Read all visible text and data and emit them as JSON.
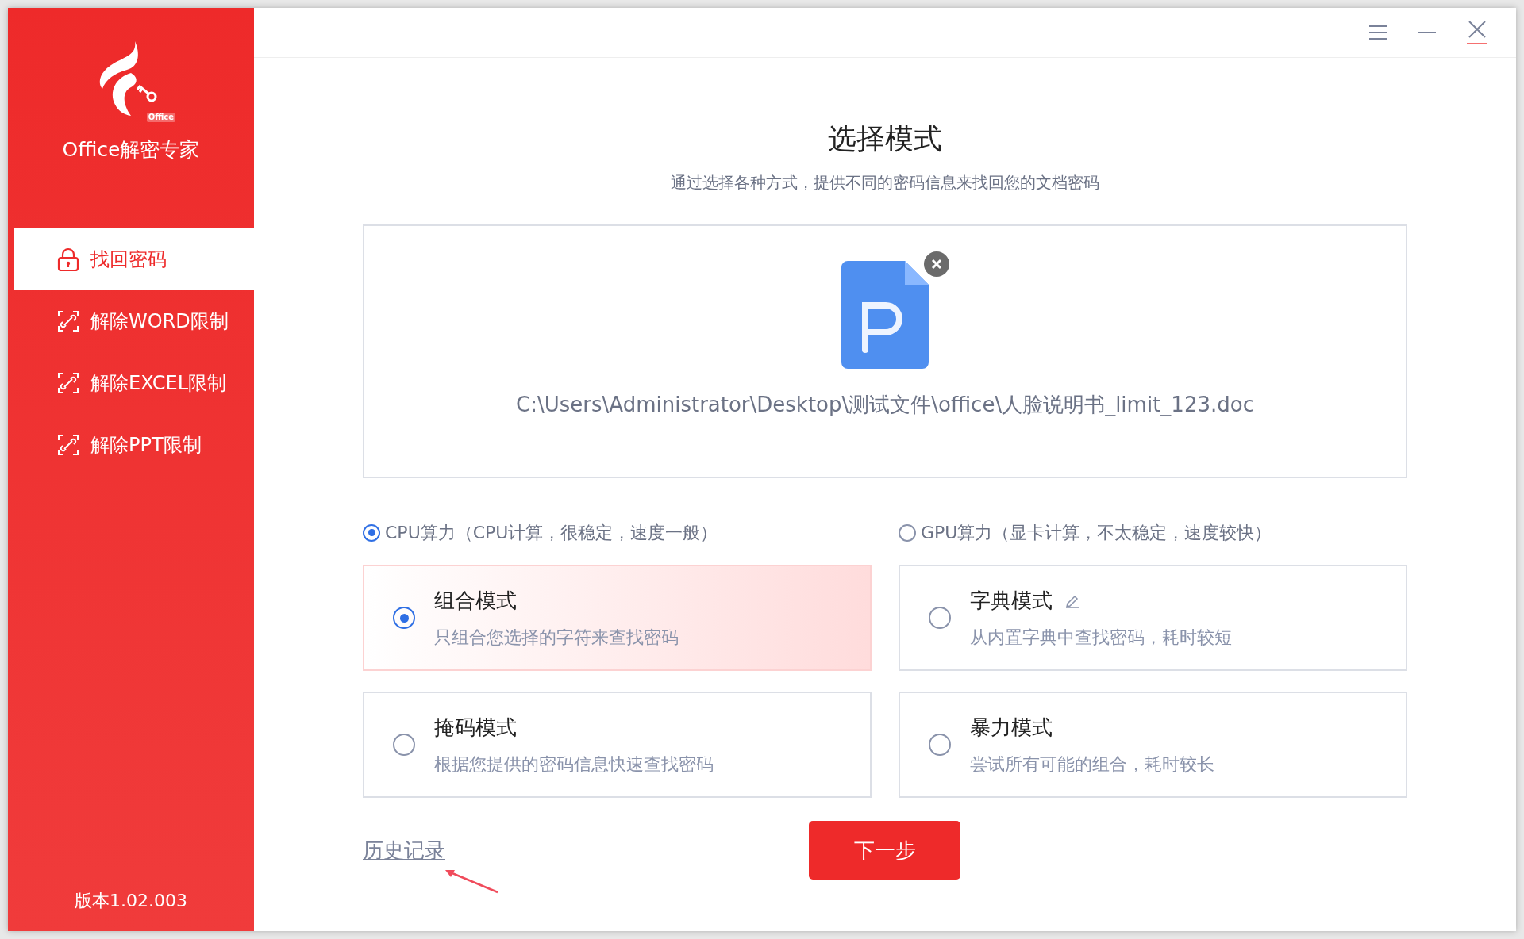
{
  "app": {
    "name": "Office解密专家",
    "logo_badge": "Office",
    "version": "版本1.02.003"
  },
  "sidebar": {
    "items": [
      {
        "label": "找回密码",
        "kind": "lock",
        "selected": true
      },
      {
        "label": "解除WORD限制",
        "kind": "unlock",
        "selected": false
      },
      {
        "label": "解除EXCEL限制",
        "kind": "unlock",
        "selected": false
      },
      {
        "label": "解除PPT限制",
        "kind": "unlock",
        "selected": false
      }
    ]
  },
  "header": {
    "title": "选择模式",
    "subtitle": "通过选择各种方式，提供不同的密码信息来找回您的文档密码"
  },
  "file": {
    "path": "C:\\Users\\Administrator\\Desktop\\测试文件\\office\\人脸说明书_limit_123.doc"
  },
  "compute": [
    {
      "label": "CPU算力（CPU计算，很稳定，速度一般）",
      "selected": true
    },
    {
      "label": "GPU算力（显卡计算，不太稳定，速度较快）",
      "selected": false
    }
  ],
  "modes": [
    {
      "title": "组合模式",
      "description": "只组合您选择的字符来查找密码",
      "selected": true,
      "editable": false
    },
    {
      "title": "字典模式",
      "description": "从内置字典中查找密码，耗时较短",
      "selected": false,
      "editable": true
    },
    {
      "title": "掩码模式",
      "description": "根据您提供的密码信息快速查找密码",
      "selected": false,
      "editable": false
    },
    {
      "title": "暴力模式",
      "description": "尝试所有可能的组合，耗时较长",
      "selected": false,
      "editable": false
    }
  ],
  "history_link": "历史记录",
  "next_button": "下一步"
}
